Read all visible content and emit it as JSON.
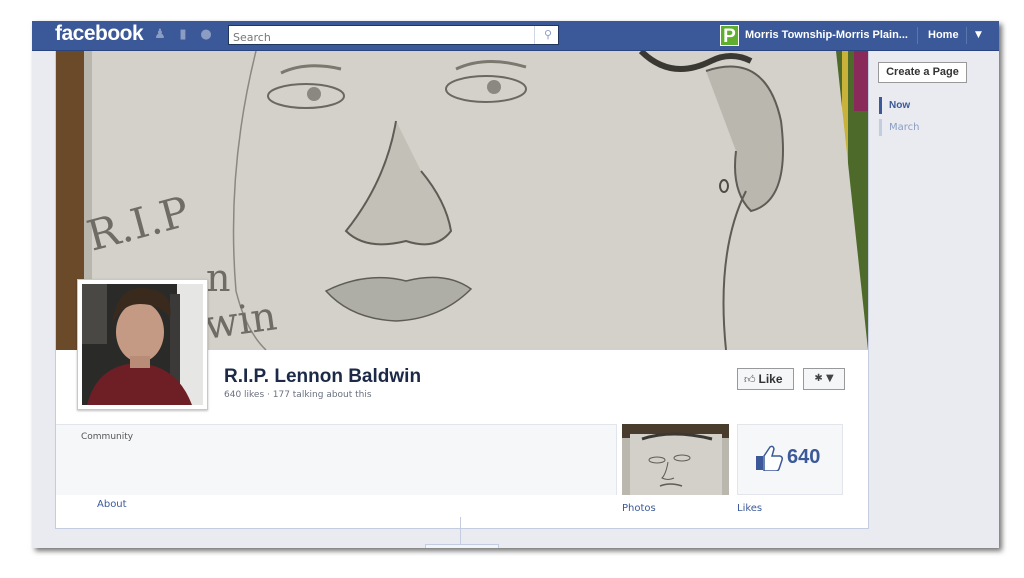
{
  "topbar": {
    "logo": "facebook",
    "search_placeholder": "Search",
    "page_icon_letter": "P",
    "page_link": "Morris Township-Morris Plain...",
    "home": "Home"
  },
  "page": {
    "cover_text": "R.I.P",
    "cover_text2": "n",
    "cover_text3": "win",
    "name": "R.I.P. Lennon Baldwin",
    "stats": "640 likes · 177 talking about this",
    "like_button": "Like",
    "category": "Community",
    "about_link": "About",
    "photos_label": "Photos",
    "likes_count": "640",
    "likes_label": "Likes"
  },
  "sidebar": {
    "create_page": "Create a Page",
    "timeline_items": [
      "Now",
      "March"
    ]
  },
  "colors": {
    "brand_blue": "#3b5998",
    "topbar_border": "#29447e",
    "page_green": "#5fae2e"
  }
}
